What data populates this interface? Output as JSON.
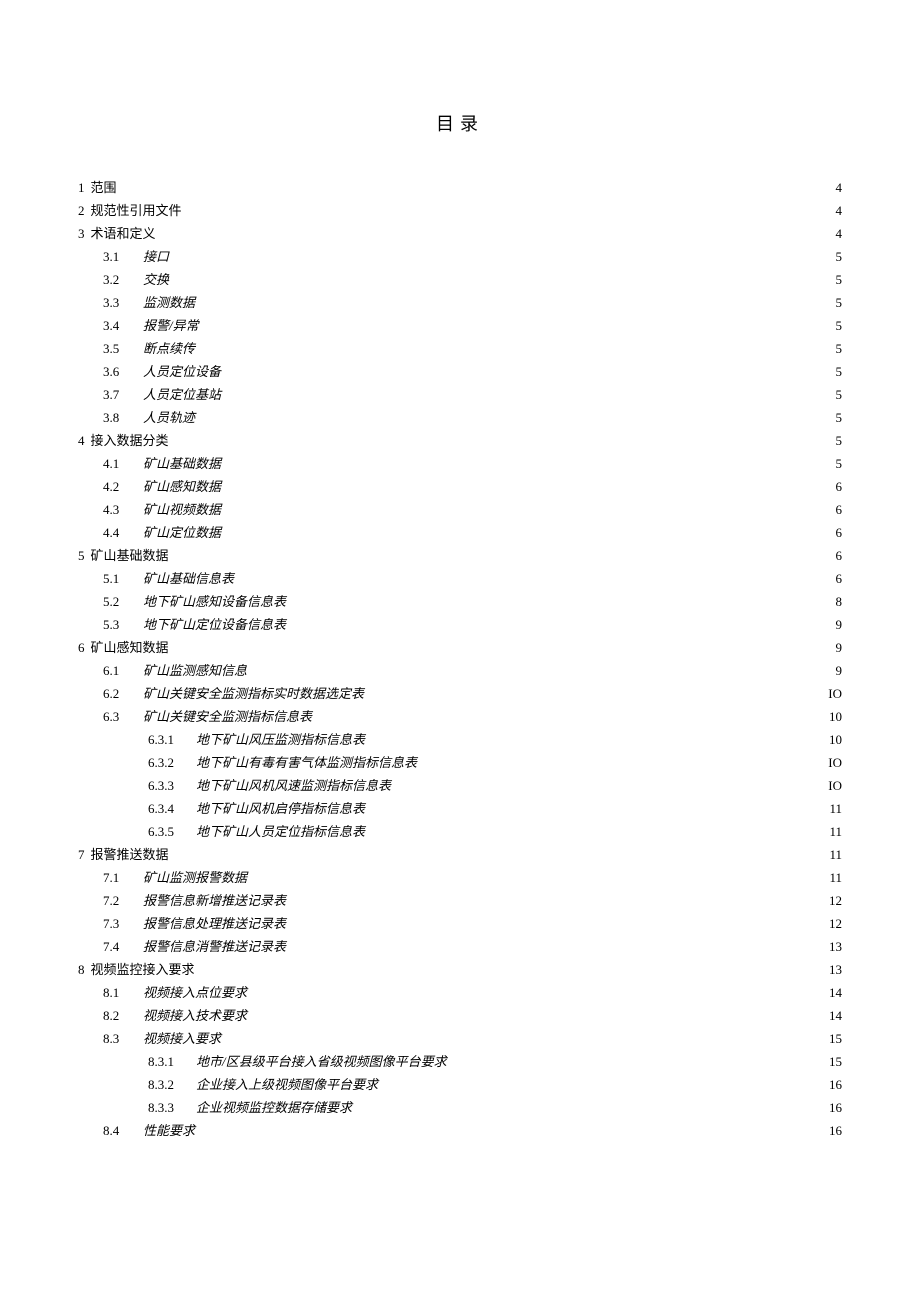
{
  "title": "目录",
  "toc": [
    {
      "level": 1,
      "num": "1",
      "text": "范围",
      "page": "4"
    },
    {
      "level": 1,
      "num": "2",
      "text": "规范性引用文件",
      "page": "4"
    },
    {
      "level": 1,
      "num": "3",
      "text": "术语和定义",
      "page": "4"
    },
    {
      "level": 2,
      "num": "3.1",
      "text": "接口",
      "page": "5"
    },
    {
      "level": 2,
      "num": "3.2",
      "text": "交换",
      "page": "5"
    },
    {
      "level": 2,
      "num": "3.3",
      "text": "监测数据",
      "page": "5"
    },
    {
      "level": 2,
      "num": "3.4",
      "text": "报警/异常",
      "page": "5"
    },
    {
      "level": 2,
      "num": "3.5",
      "text": "断点续传",
      "page": "5"
    },
    {
      "level": 2,
      "num": "3.6",
      "text": "人员定位设备",
      "page": "5"
    },
    {
      "level": 2,
      "num": "3.7",
      "text": "人员定位基站",
      "page": "5"
    },
    {
      "level": 2,
      "num": "3.8",
      "text": "人员轨迹",
      "page": "5"
    },
    {
      "level": 1,
      "num": "4",
      "text": "接入数据分类",
      "page": "5"
    },
    {
      "level": 2,
      "num": "4.1",
      "text": "矿山基础数据",
      "page": "5"
    },
    {
      "level": 2,
      "num": "4.2",
      "text": "矿山感知数据",
      "page": "6"
    },
    {
      "level": 2,
      "num": "4.3",
      "text": "矿山视频数据",
      "page": "6"
    },
    {
      "level": 2,
      "num": "4.4",
      "text": "矿山定位数据",
      "page": "6"
    },
    {
      "level": 1,
      "num": "5",
      "text": "矿山基础数据",
      "page": "6"
    },
    {
      "level": 2,
      "num": "5.1",
      "text": "矿山基础信息表",
      "page": "6"
    },
    {
      "level": 2,
      "num": "5.2",
      "text": "地下矿山感知设备信息表",
      "page": "8"
    },
    {
      "level": 2,
      "num": "5.3",
      "text": "地下矿山定位设备信息表",
      "page": "9"
    },
    {
      "level": 1,
      "num": "6",
      "text": "矿山感知数据",
      "page": "9"
    },
    {
      "level": 2,
      "num": "6.1",
      "text": "矿山监测感知信息",
      "page": "9"
    },
    {
      "level": 2,
      "num": "6.2",
      "text": "矿山关键安全监测指标实时数据选定表",
      "page": "IO"
    },
    {
      "level": 2,
      "num": "6.3",
      "text": "矿山关键安全监测指标信息表",
      "page": "10"
    },
    {
      "level": 3,
      "num": "6.3.1",
      "text": "地下矿山风压监测指标信息表",
      "page": "10"
    },
    {
      "level": 3,
      "num": "6.3.2",
      "text": "地下矿山有毒有害气体监测指标信息表",
      "page": "IO"
    },
    {
      "level": 3,
      "num": "6.3.3",
      "text": "地下矿山风机风速监测指标信息表",
      "page": "IO"
    },
    {
      "level": 3,
      "num": "6.3.4",
      "text": "地下矿山风机启停指标信息表",
      "page": "11"
    },
    {
      "level": 3,
      "num": "6.3.5",
      "text": "地下矿山人员定位指标信息表",
      "page": "11"
    },
    {
      "level": 1,
      "num": "7",
      "text": "报警推送数据",
      "page": "11"
    },
    {
      "level": 2,
      "num": "7.1",
      "text": "矿山监测报警数据",
      "page": "11"
    },
    {
      "level": 2,
      "num": "7.2",
      "text": "报警信息新增推送记录表",
      "page": "12"
    },
    {
      "level": 2,
      "num": "7.3",
      "text": "报警信息处理推送记录表",
      "page": "12"
    },
    {
      "level": 2,
      "num": "7.4",
      "text": "报警信息消警推送记录表",
      "page": "13"
    },
    {
      "level": 1,
      "num": "8",
      "text": "视频监控接入要求",
      "page": "13"
    },
    {
      "level": 2,
      "num": "8.1",
      "text": "视频接入点位要求",
      "page": "14"
    },
    {
      "level": 2,
      "num": "8.2",
      "text": "视频接入技术要求",
      "page": "14"
    },
    {
      "level": 2,
      "num": "8.3",
      "text": "视频接入要求",
      "page": "15"
    },
    {
      "level": 3,
      "num": "8.3.1",
      "text": "地市/区县级平台接入省级视频图像平台要求",
      "page": "15"
    },
    {
      "level": 3,
      "num": "8.3.2",
      "text": "企业接入上级视频图像平台要求",
      "page": "16"
    },
    {
      "level": 3,
      "num": "8.3.3",
      "text": "企业视频监控数据存储要求",
      "page": "16"
    },
    {
      "level": 2,
      "num": "8.4",
      "text": "性能要求",
      "page": "16"
    }
  ]
}
